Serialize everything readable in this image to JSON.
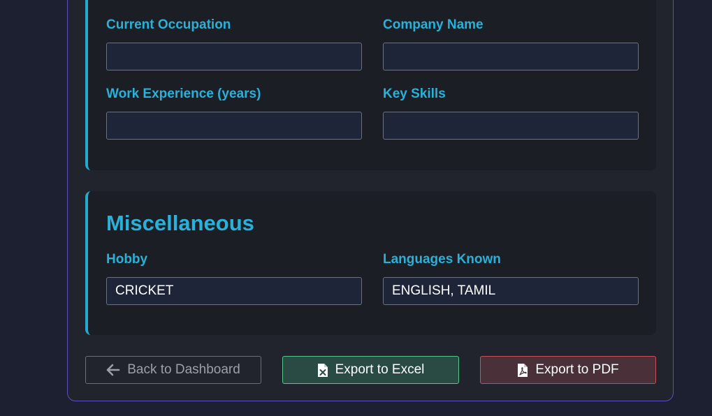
{
  "professional": {
    "occupation_label": "Current Occupation",
    "occupation_value": "",
    "company_label": "Company Name",
    "company_value": "",
    "experience_label": "Work Experience (years)",
    "experience_value": "",
    "skills_label": "Key Skills",
    "skills_value": ""
  },
  "misc": {
    "title": "Miscellaneous",
    "hobby_label": "Hobby",
    "hobby_value": "CRICKET",
    "languages_label": "Languages Known",
    "languages_value": "ENGLISH, TAMIL"
  },
  "actions": {
    "back_label": "Back to Dashboard",
    "excel_label": "Export to Excel",
    "pdf_label": "Export to PDF"
  },
  "icons": {
    "back": "arrow-left-icon",
    "excel": "file-excel-icon",
    "pdf": "file-pdf-icon"
  },
  "colors": {
    "accent": "#29b1d9",
    "frame_border": "#5b4fc4",
    "excel_border": "#58c58b",
    "pdf_border": "#c95058"
  }
}
